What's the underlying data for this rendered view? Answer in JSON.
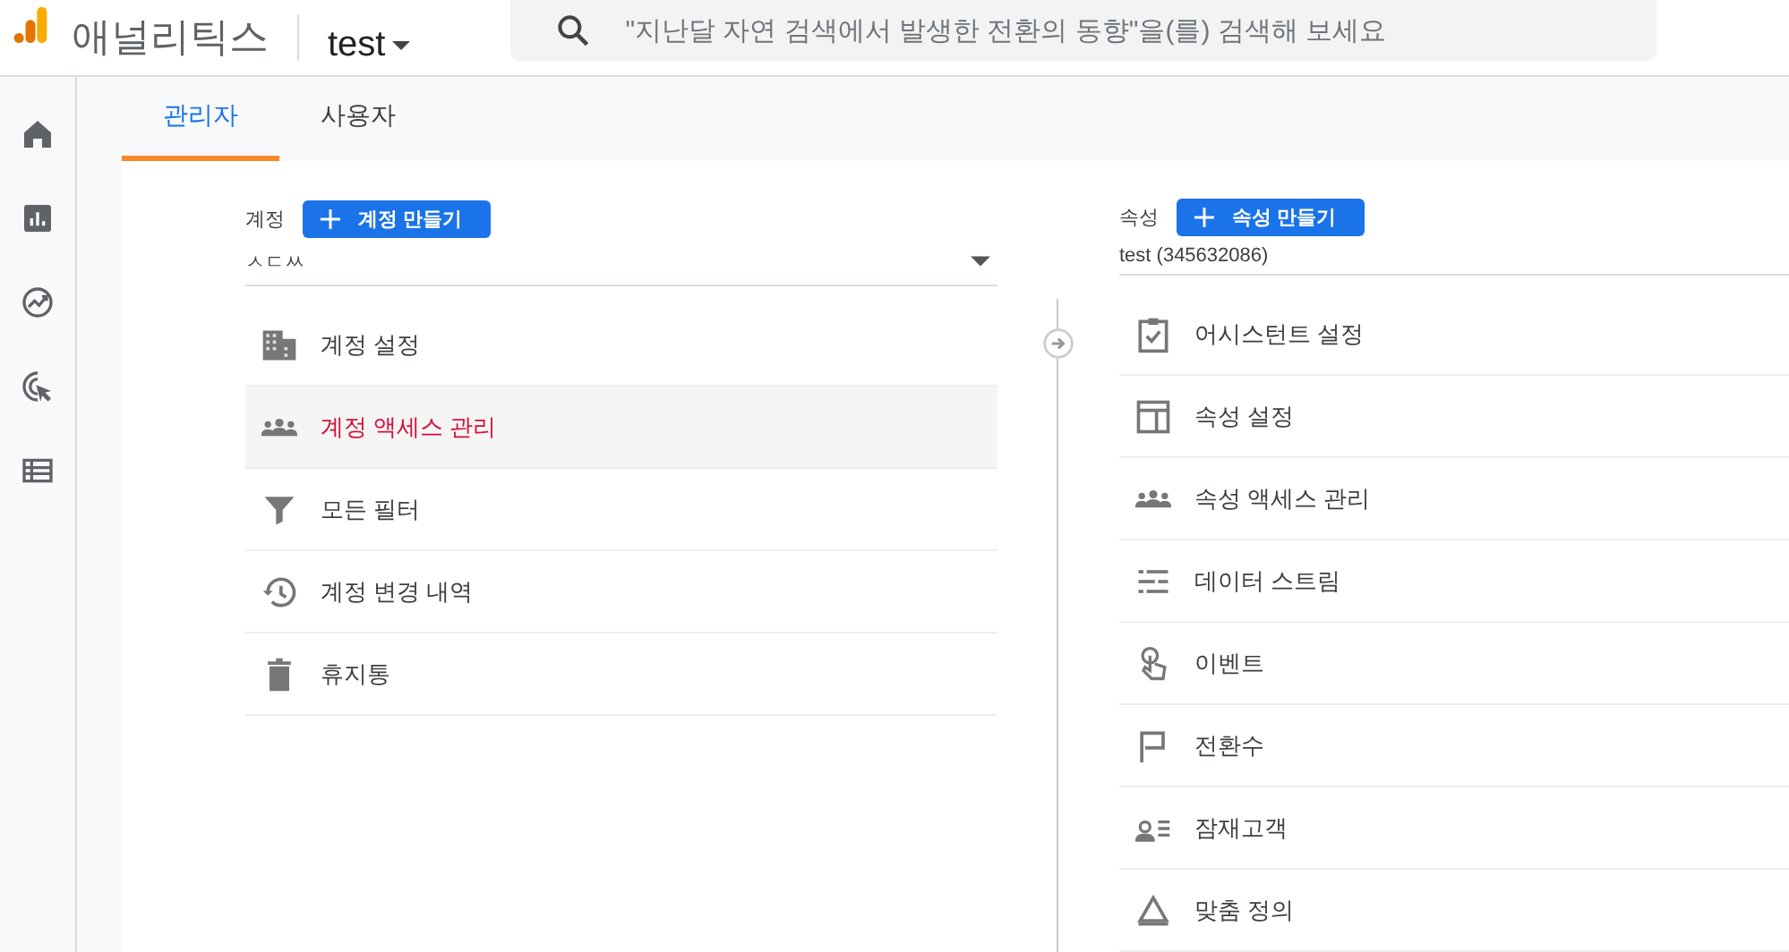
{
  "header": {
    "app_name": "애널리틱스",
    "account_selector": "test",
    "search": {
      "placeholder": "\"지난달 자연 검색에서 발생한 전환의 동향\"을(를) 검색해 보세요"
    }
  },
  "tabs": [
    {
      "label": "관리자",
      "selected": true
    },
    {
      "label": "사용자",
      "selected": false
    }
  ],
  "account_column": {
    "label": "계정",
    "create_button": "계정 만들기",
    "selector_value": "ㅅㄷㅆ",
    "items": [
      {
        "label": "계정 설정",
        "selected": false
      },
      {
        "label": "계정 액세스 관리",
        "selected": true
      },
      {
        "label": "모든 필터",
        "selected": false
      },
      {
        "label": "계정 변경 내역",
        "selected": false
      },
      {
        "label": "휴지통",
        "selected": false
      }
    ]
  },
  "property_column": {
    "label": "속성",
    "create_button": "속성 만들기",
    "selector_value": "test (345632086)",
    "items": [
      {
        "label": "어시스턴트 설정",
        "selected": false
      },
      {
        "label": "속성 설정",
        "selected": false
      },
      {
        "label": "속성 액세스 관리",
        "selected": false
      },
      {
        "label": "데이터 스트림",
        "selected": false
      },
      {
        "label": "이벤트",
        "selected": false
      },
      {
        "label": "전환수",
        "selected": false
      },
      {
        "label": "잠재고객",
        "selected": false
      },
      {
        "label": "맞춤 정의",
        "selected": false
      }
    ]
  }
}
